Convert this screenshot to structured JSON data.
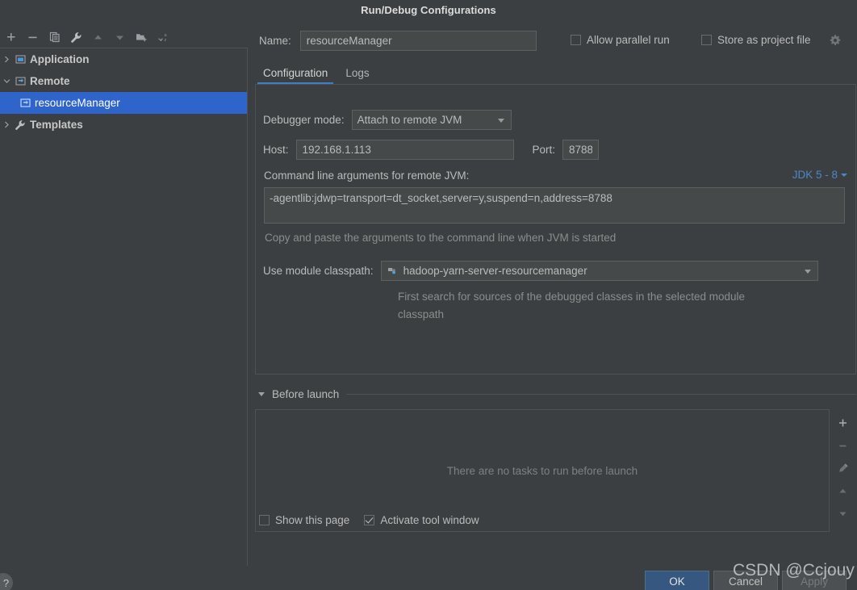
{
  "window": {
    "title": "Run/Debug Configurations"
  },
  "toolbar": {
    "buttons": [
      {
        "name": "add-configuration-button",
        "icon": "plus-icon",
        "tooltip": "Add New Configuration"
      },
      {
        "name": "remove-configuration-button",
        "icon": "minus-icon",
        "tooltip": "Remove Configuration"
      },
      {
        "name": "copy-configuration-button",
        "icon": "copy-icon",
        "tooltip": "Copy Configuration"
      },
      {
        "name": "edit-templates-button",
        "icon": "wrench-icon",
        "tooltip": "Edit Templates"
      },
      {
        "name": "move-up-button",
        "icon": "arrow-up-icon",
        "tooltip": "Move Up"
      },
      {
        "name": "move-down-button",
        "icon": "arrow-down-icon",
        "tooltip": "Move Down"
      },
      {
        "name": "move-into-folder-button",
        "icon": "folder-add-icon",
        "tooltip": "Create New Folder"
      },
      {
        "name": "sort-configurations-button",
        "icon": "sort-alpha-icon",
        "tooltip": "Sort Configurations"
      }
    ]
  },
  "tree": {
    "items": [
      {
        "label": "Application",
        "icon": "application-icon",
        "twisty": "collapsed",
        "level": 1,
        "selected": false,
        "bold": true
      },
      {
        "label": "Remote",
        "icon": "remote-icon",
        "twisty": "expanded",
        "level": 1,
        "selected": false,
        "bold": true
      },
      {
        "label": "resourceManager",
        "icon": "remote-icon",
        "twisty": "none",
        "level": 2,
        "selected": true,
        "bold": false
      },
      {
        "label": "Templates",
        "icon": "wrench-icon",
        "twisty": "collapsed",
        "level": 1,
        "selected": false,
        "bold": true
      }
    ]
  },
  "form": {
    "name_label": "Name:",
    "name_value": "resourceManager",
    "allow_parallel_run": {
      "label": "Allow parallel run",
      "checked": false
    },
    "store_as_project_file": {
      "label": "Store as project file",
      "checked": false
    },
    "gear_icon": "gear-icon"
  },
  "tabs": [
    {
      "label": "Configuration",
      "active": true
    },
    {
      "label": "Logs",
      "active": false
    }
  ],
  "configuration": {
    "debugger_mode_label": "Debugger mode:",
    "debugger_mode_value": "Attach to remote JVM",
    "host_label": "Host:",
    "host_value": "192.168.1.113",
    "port_label": "Port:",
    "port_value": "8788",
    "command_line_label": "Command line arguments for remote JVM:",
    "jdk_selector": "JDK 5 - 8",
    "command_line_value": "-agentlib:jdwp=transport=dt_socket,server=y,suspend=n,address=8788",
    "command_line_hint": "Copy and paste the arguments to the command line when JVM is started",
    "module_classpath_label": "Use module classpath:",
    "module_classpath_value": "hadoop-yarn-server-resourcemanager",
    "module_classpath_icon": "module-icon",
    "module_classpath_hint": "First search for sources of the debugged classes in the selected module classpath"
  },
  "before_launch": {
    "title": "Before launch",
    "empty_message": "There are no tasks to run before launch",
    "side_buttons": [
      {
        "name": "add-task-button",
        "icon": "plus-icon"
      },
      {
        "name": "remove-task-button",
        "icon": "minus-icon"
      },
      {
        "name": "edit-task-button",
        "icon": "pencil-icon"
      },
      {
        "name": "move-task-up-button",
        "icon": "arrow-up-icon"
      },
      {
        "name": "move-task-down-button",
        "icon": "arrow-down-icon"
      }
    ],
    "show_this_page": {
      "label": "Show this page",
      "checked": false
    },
    "activate_tool_window": {
      "label": "Activate tool window",
      "checked": true
    }
  },
  "footer": {
    "help_label": "?",
    "ok_label": "OK",
    "cancel_label": "Cancel",
    "apply_label": "Apply"
  },
  "watermark": {
    "text": "CSDN @Ccjouy"
  },
  "colors": {
    "background": "#3c3f41",
    "field_background": "#45494a",
    "selection_blue": "#2f65ca",
    "accent_tab": "#3d7ec4",
    "link_blue": "#4d87c7",
    "ok_button": "#365880",
    "text": "#bbbbbb",
    "muted_text": "#8c8c8c"
  }
}
